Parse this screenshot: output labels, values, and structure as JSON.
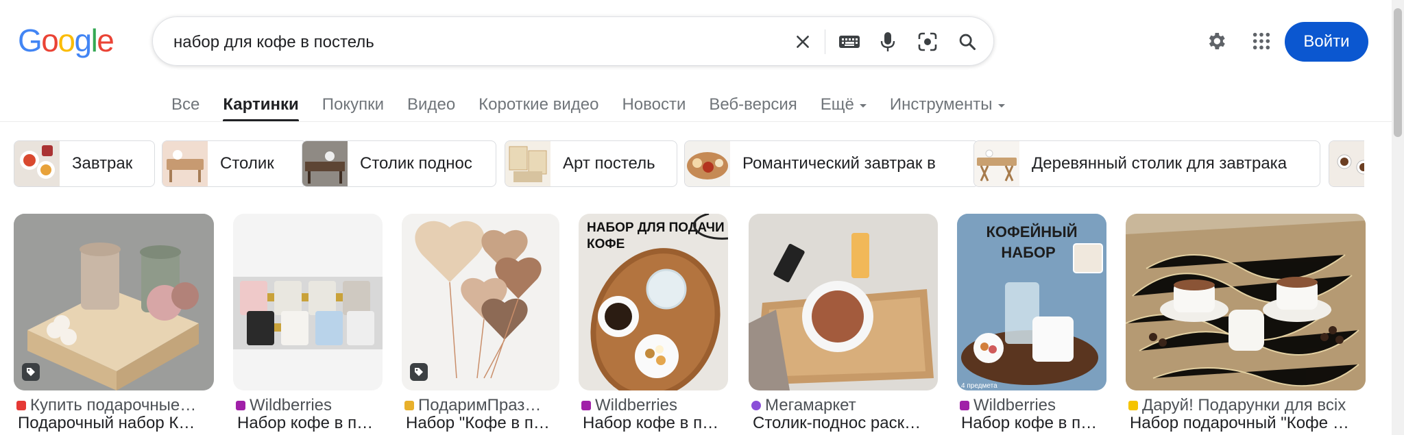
{
  "logo": "Google",
  "search": {
    "query": "набор для кофе в постель"
  },
  "header": {
    "signin_label": "Войти"
  },
  "tabs": [
    {
      "label": "Все"
    },
    {
      "label": "Картинки"
    },
    {
      "label": "Покупки"
    },
    {
      "label": "Видео"
    },
    {
      "label": "Короткие видео"
    },
    {
      "label": "Новости"
    },
    {
      "label": "Веб-версия"
    },
    {
      "label": "Ещё"
    },
    {
      "label": "Инструменты"
    }
  ],
  "chips": [
    {
      "label": "Завтрак"
    },
    {
      "label": "Столик"
    },
    {
      "label": "Столик поднос"
    },
    {
      "label": "Арт постель"
    },
    {
      "label": "Романтический завтрак в"
    },
    {
      "label": "Деревянный столик для завтрака"
    }
  ],
  "results": [
    {
      "source": "Купить подарочные…",
      "title": "Подарочный набор К…"
    },
    {
      "source": "Wildberries",
      "title": "Набор кофе в п…"
    },
    {
      "source": "ПодаримПраз…",
      "title": "Набор \"Кофе в п…"
    },
    {
      "source": "Wildberries",
      "title": "Набор кофе в п…"
    },
    {
      "source": "Мегамаркет",
      "title": "Столик-поднос раск…"
    },
    {
      "source": "Wildberries",
      "title": "Набор кофе в п…"
    },
    {
      "source": "Даруй! Подарунки для всіх",
      "title": "Набор подарочный \"Кофе …"
    }
  ],
  "image_text": {
    "r4_title": "НАБОР ДЛЯ ПОДАЧИ КОФЕ",
    "r6_title_1": "КОФЕЙНЫЙ",
    "r6_title_2": "НАБОР",
    "r6_note": "4 предмета"
  },
  "icons": {
    "clear": "close-icon",
    "keyboard": "keyboard-icon",
    "voice": "mic-icon",
    "lens": "lens-icon",
    "search": "search-icon",
    "settings": "gear-icon",
    "apps": "apps-grid-icon"
  },
  "colors": {
    "signin_bg": "#0b57d0",
    "active_tab": "#202124",
    "muted_text": "#70757a"
  }
}
